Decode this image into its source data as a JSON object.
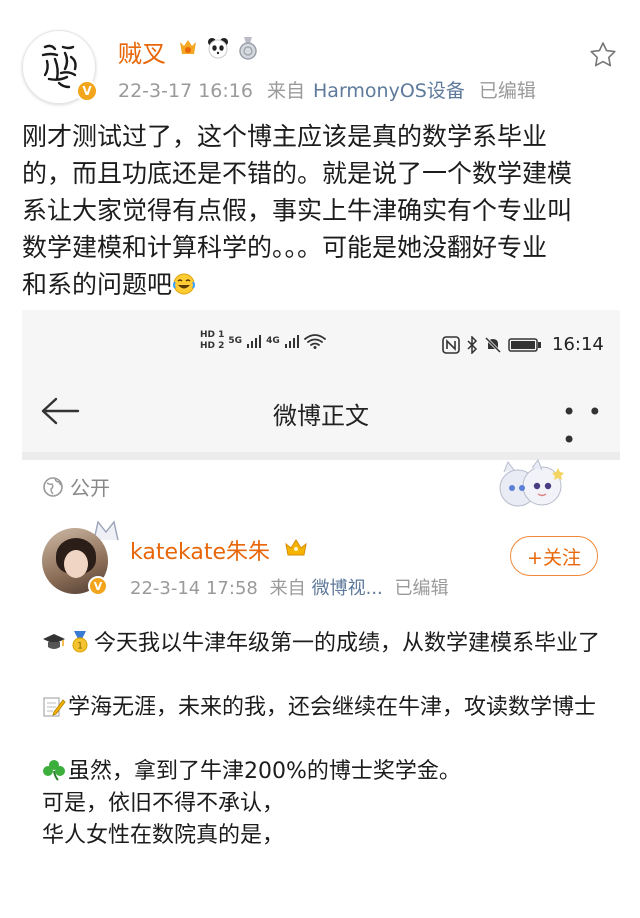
{
  "outer_post": {
    "username": "贼叉",
    "timestamp": "22-3-17 16:16",
    "source_prefix": "来自",
    "source": "HarmonyOS设备",
    "edited": "已编辑",
    "avatar_badge": "V",
    "body_lines": [
      "刚才测试过了，这个博主应该是真的数学系毕业",
      "的，而且功底还是不错的。就是说了一个数学建模",
      "系让大家觉得有点假，事实上牛津确实有个专业叫",
      "数学建模和计算科学的。。。可能是她没翻好专业",
      "和系的问题吧"
    ],
    "medal_icons": [
      "fire-medal-icon",
      "panda-medal-icon",
      "silver-medal-icon"
    ],
    "end_emoji": "laughing-tears-emoji"
  },
  "screenshot": {
    "statusbar": {
      "time": "16:14",
      "sim1": "HD 1",
      "sim2": "HD 2",
      "net1": "5G",
      "net2": "4G"
    },
    "navbar": {
      "title": "微博正文",
      "more": "• • •"
    },
    "visibility": "公开",
    "inner_post": {
      "username": "katekate朱朱",
      "timestamp": "22-3-14 17:58",
      "source_prefix": "来自",
      "source": "微博视...",
      "edited": "已编辑",
      "follow_label": "+关注",
      "avatar_badge": "V",
      "paragraphs": [
        "今天我以牛津年级第一的成绩，从数学建模系毕业了",
        "学海无涯，未来的我，还会继续在牛津，攻读数学博士"
      ],
      "para3_lines": [
        "虽然，拿到了牛津200%的博士奖学金。",
        "可是，依旧不得不承认，",
        "华人女性在数院真的是，"
      ]
    }
  },
  "colors": {
    "username": "#e8670a",
    "meta": "#9a9a9a",
    "source_link": "#5e7a9b",
    "verified": "#f2a51a"
  }
}
